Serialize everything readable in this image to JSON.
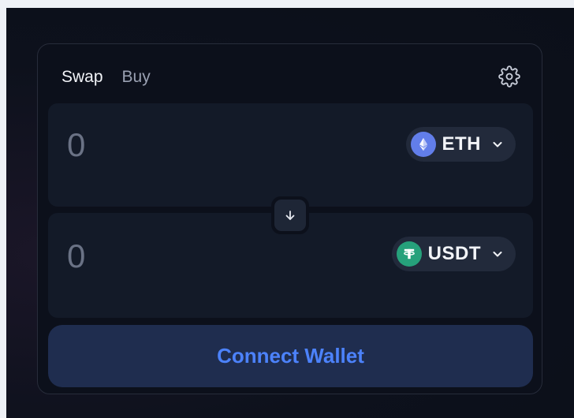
{
  "tabs": [
    {
      "label": "Swap",
      "active": true
    },
    {
      "label": "Buy",
      "active": false
    }
  ],
  "settings_icon": "gear-icon",
  "input_panel": {
    "amount": "0",
    "token": {
      "symbol": "ETH",
      "icon": "eth-icon",
      "color": "#627eea"
    }
  },
  "output_panel": {
    "amount": "0",
    "token": {
      "symbol": "USDT",
      "icon": "usdt-icon",
      "color": "#26a17b"
    }
  },
  "switch_icon": "arrow-down-icon",
  "connect_button": {
    "label": "Connect Wallet",
    "color": "#4c82fb"
  }
}
